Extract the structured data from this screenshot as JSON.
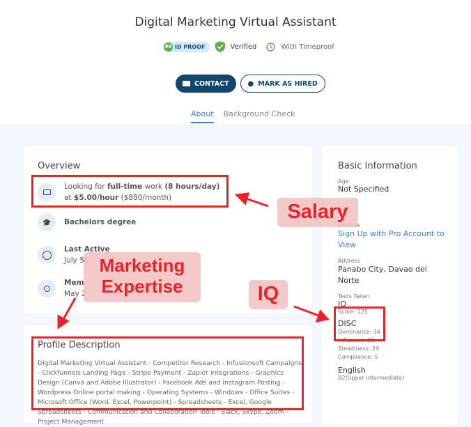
{
  "header": {
    "title": "Digital Marketing Virtual Assistant",
    "id_proof_score": "99",
    "id_proof": "ID PROOF",
    "verified": "Verified",
    "timeproof": "With Timeproof"
  },
  "actions": {
    "contact": "CONTACT",
    "mark_hired": "MARK AS HIRED"
  },
  "tabs": [
    {
      "label": "About",
      "active": true
    },
    {
      "label": "Background Check",
      "active": false
    }
  ],
  "overview": {
    "title": "Overview",
    "work": {
      "a": "Looking for ",
      "b": "full-time",
      "c": " work ",
      "d": "(8 hours/day)",
      "e": "at ",
      "f": "$5.00/hour",
      "g": " ($880/month)"
    },
    "education": "Bachelors degree",
    "last_active_label": "Last Active",
    "last_active_value": "July 5t",
    "member_label": "Mem",
    "member_value": "May 2"
  },
  "profile": {
    "title": "Profile Description",
    "text": "Digital Marketing Virtual Assistant - Competitor Research - Infusionsoft Campaigns - Clickfunnels Landing Page - Stripe Payment - Zapier Integrations - Graphics Design (Canva and Adobe Illustrator) - Facebook Ads and Instagram Posting - Wordpress Online portal making - Operating Systems - Windows - Office Suites - Microsoft Office (Word, Excel, Powerpoint) - Spreadsheets - Excel, Google Spreadsheets - Communication and Collaboration Tools - Slack, Skype, Zoom - Project Management"
  },
  "basic": {
    "title": "Basic Information",
    "age_label": "Age",
    "age": "Not Specified",
    "gender_fragment": "le",
    "website_label": "Website",
    "website": "Sign Up with Pro Account to View",
    "address_label": "Address",
    "address": "Panabo City, Davao del Norte",
    "tests_label": "Tests Taken",
    "iq": "IQ",
    "iq_score": "Score:  125",
    "disc": "DISC",
    "disc_items": [
      "Dominance: 34",
      "Influence: 31",
      "Steadiness: 29",
      "Compliance: 5"
    ],
    "english": "English",
    "english_level": "B2(Upper Intermediate)"
  },
  "annotations": {
    "salary": "Salary",
    "marketing": "Marketing Expertise",
    "iq": "IQ"
  },
  "colors": {
    "primary": "#11466e",
    "link": "#3b7fcf",
    "annotation": "#e8242b"
  }
}
